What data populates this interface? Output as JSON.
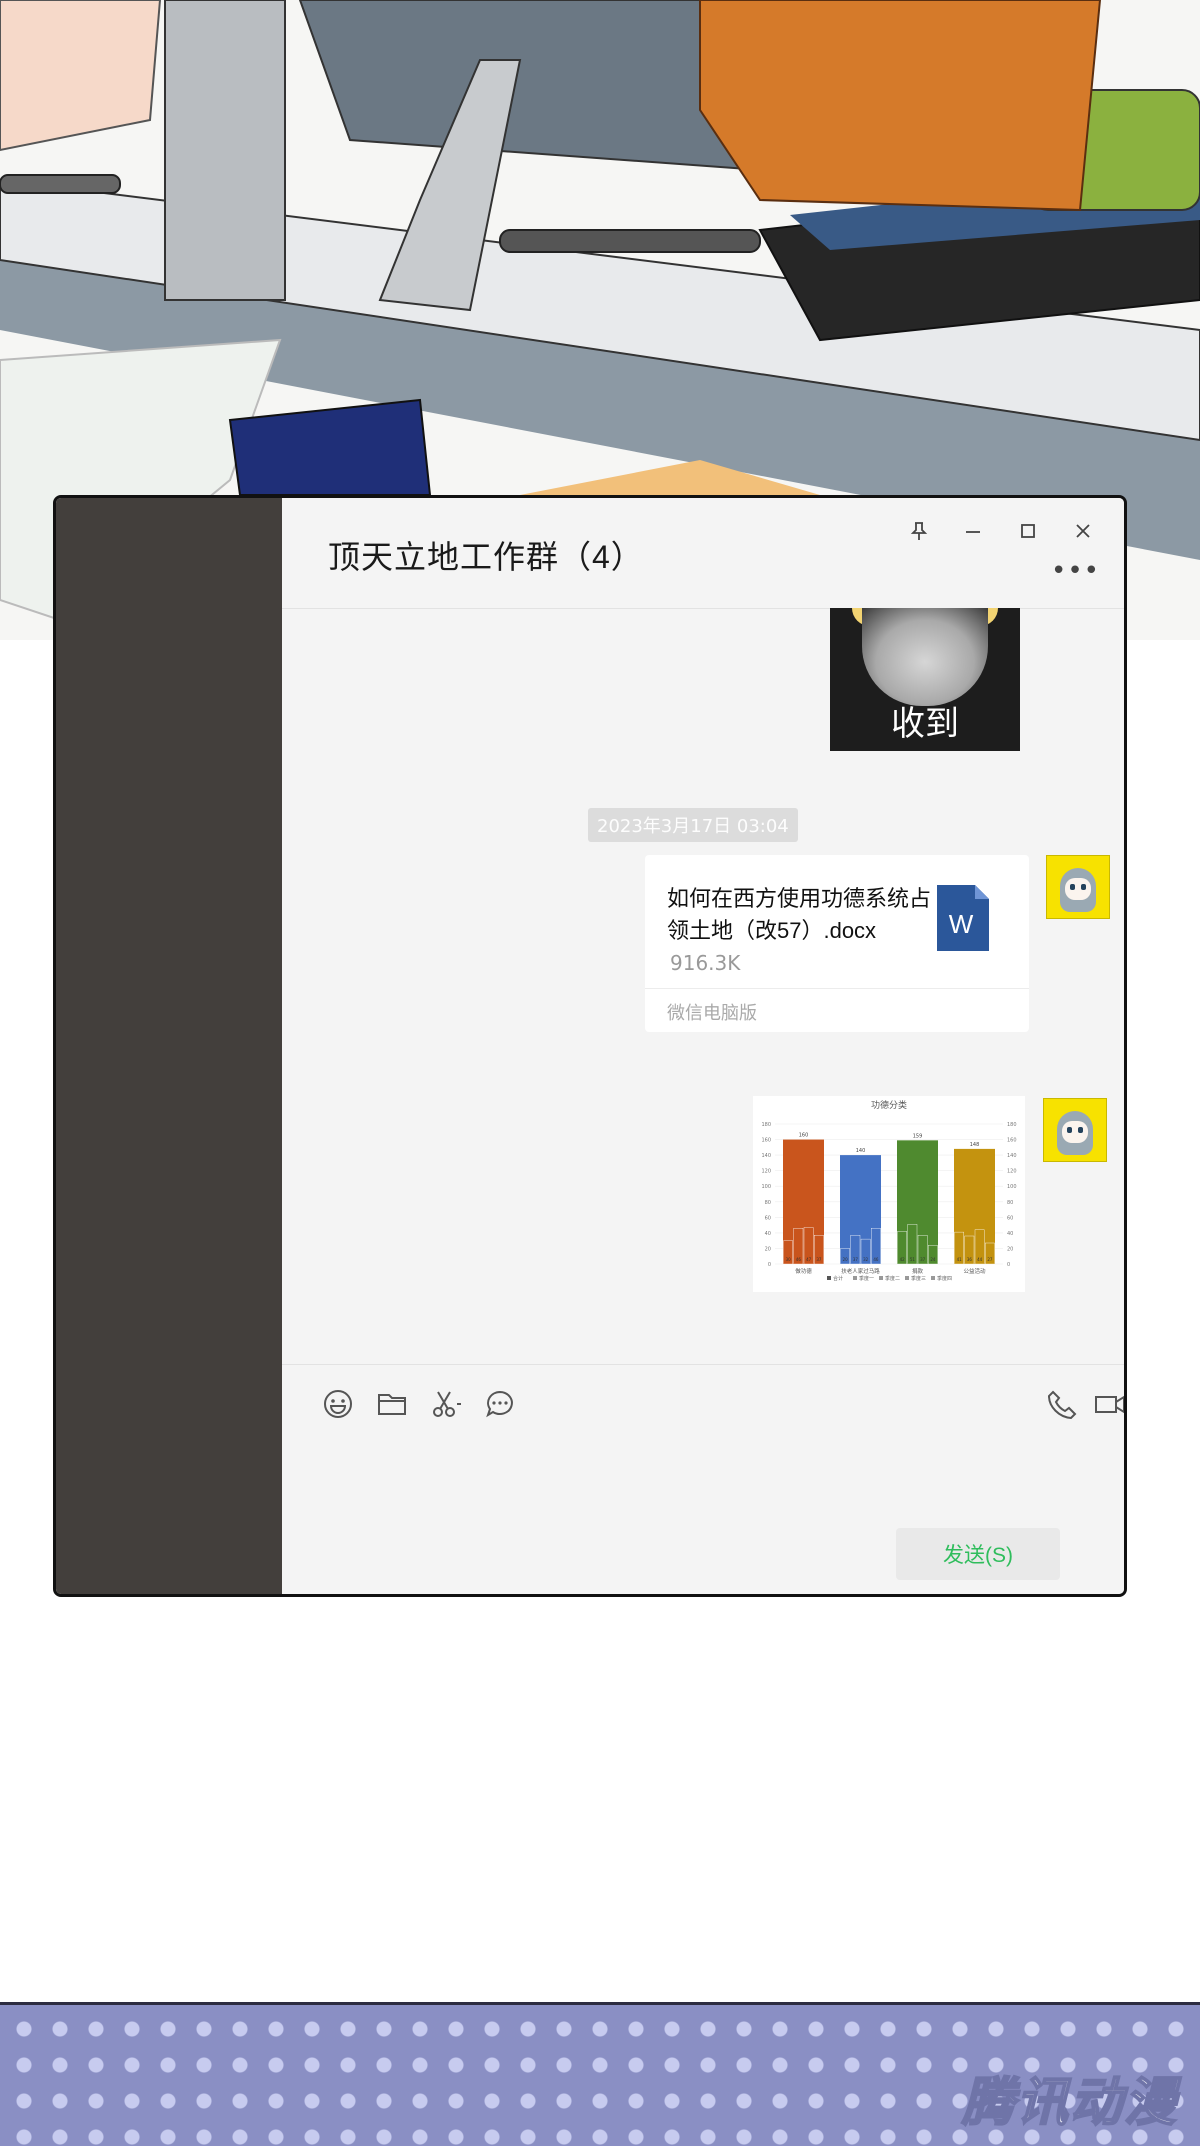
{
  "chat": {
    "title": "顶天立地工作群（4）",
    "sticker_caption": "收到",
    "timestamp": "2023年3月17日 03:04",
    "file": {
      "name": "如何在西方使用功德系统占领土地（改57）.docx",
      "size": "916.3K",
      "source": "微信电脑版",
      "icon_letter": "W"
    },
    "send_label": "发送(S)"
  },
  "icons": {
    "pin": "pin-icon",
    "minimize": "minimize-icon",
    "maximize": "maximize-icon",
    "close": "close-icon",
    "more": "more-icon",
    "emoji": "emoji-icon",
    "folder": "folder-icon",
    "scissors": "scissors-icon",
    "chat_history": "chat-history-icon",
    "phone": "phone-icon",
    "video": "video-icon"
  },
  "colors": {
    "sidebar": "#433f3c",
    "send_text": "#2fbd5c",
    "word_blue": "#2b579a"
  },
  "chart_data": {
    "type": "bar",
    "title": "功德分类",
    "categories": [
      "做功德",
      "扶老人家过马路",
      "捐款",
      "公益活动"
    ],
    "totals": [
      160,
      140,
      159,
      148
    ],
    "series": [
      {
        "name": "合计",
        "values": [
          160,
          140,
          159,
          148
        ]
      },
      {
        "name": "季度一",
        "values": [
          30,
          20,
          42,
          41
        ]
      },
      {
        "name": "季度二",
        "values": [
          46,
          37,
          51,
          36
        ]
      },
      {
        "name": "季度三",
        "values": [
          47,
          32,
          37,
          44
        ]
      },
      {
        "name": "季度四",
        "values": [
          37,
          46,
          24,
          27
        ]
      }
    ],
    "colors": [
      "#c9551d",
      "#4472c4",
      "#4f8a2f",
      "#c4930f"
    ],
    "ylim": [
      0,
      180
    ],
    "yticks": [
      0,
      20,
      40,
      60,
      80,
      100,
      120,
      140,
      160,
      180
    ]
  }
}
